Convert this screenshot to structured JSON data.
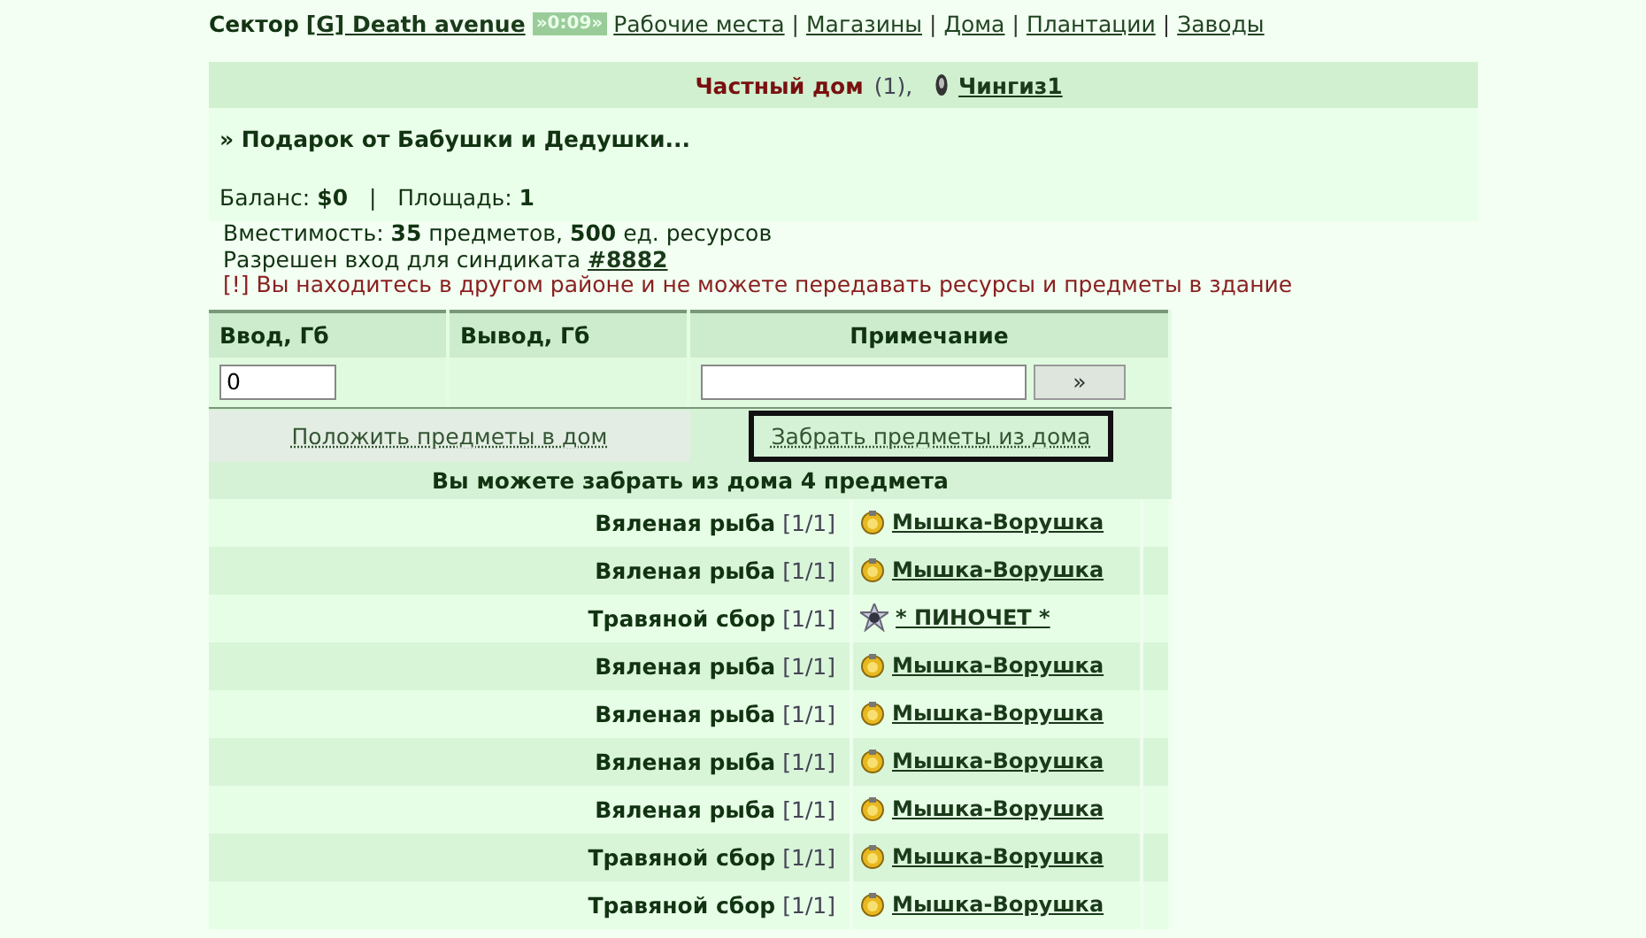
{
  "nav": {
    "label": "Сектор",
    "sector": "[G] Death avenue",
    "timer": "»0:09»",
    "separator": "|",
    "links": [
      "Рабочие места",
      "Магазины",
      "Дома",
      "Плантации",
      "Заводы"
    ]
  },
  "house": {
    "type": "Частный дом",
    "count": "(1),",
    "owner": "Чингиз1",
    "gift": "» Подарок от Бабушки и Дедушки...",
    "balance_label": "Баланс:",
    "balance": "$0",
    "divider": "|",
    "area_label": "Площадь:",
    "area": "1",
    "capacity_label": "Вместимость:",
    "capacity_items": "35",
    "items_word": "предметов,",
    "capacity_res": "500",
    "res_word": "ед. ресурсов",
    "syndicate_label": "Разрешен вход для синдиката",
    "syndicate": "#8882",
    "warning": "[!] Вы находитесь в другом районе и не можете передавать ресурсы и предметы в здание"
  },
  "transfer": {
    "columns": [
      "Ввод, Гб",
      "Вывод, Гб",
      "Примечание"
    ],
    "input_value": "0",
    "submit": "»"
  },
  "tabs": [
    {
      "label": "Положить предметы в дом",
      "selected": false
    },
    {
      "label": "Забрать предметы из дома",
      "selected": true
    }
  ],
  "notice": "Вы можете забрать из дома 4 предмета",
  "items": [
    {
      "name": "Вяленая рыба",
      "qty": "[1/1]",
      "kind": "medal",
      "owner": "Мышка-Ворушка"
    },
    {
      "name": "Вяленая рыба",
      "qty": "[1/1]",
      "kind": "medal",
      "owner": "Мышка-Ворушка"
    },
    {
      "name": "Травяной сбор",
      "qty": "[1/1]",
      "kind": "star",
      "owner": "* ПИНОЧЕТ *"
    },
    {
      "name": "Вяленая рыба",
      "qty": "[1/1]",
      "kind": "medal",
      "owner": "Мышка-Ворушка"
    },
    {
      "name": "Вяленая рыба",
      "qty": "[1/1]",
      "kind": "medal",
      "owner": "Мышка-Ворушка"
    },
    {
      "name": "Вяленая рыба",
      "qty": "[1/1]",
      "kind": "medal",
      "owner": "Мышка-Ворушка"
    },
    {
      "name": "Вяленая рыба",
      "qty": "[1/1]",
      "kind": "medal",
      "owner": "Мышка-Ворушка"
    },
    {
      "name": "Травяной сбор",
      "qty": "[1/1]",
      "kind": "medal",
      "owner": "Мышка-Ворушка"
    },
    {
      "name": "Травяной сбор",
      "qty": "[1/1]",
      "kind": "medal",
      "owner": "Мышка-Ворушка"
    }
  ]
}
